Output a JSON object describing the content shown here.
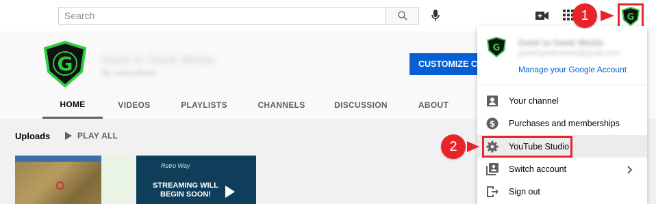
{
  "search": {
    "placeholder": "Search"
  },
  "channel": {
    "name": "Geek to Geek Media",
    "subscribers": "No subscribers",
    "customize_label": "CUSTOMIZE CHANNEL"
  },
  "tabs": [
    {
      "label": "HOME",
      "active": true
    },
    {
      "label": "VIDEOS",
      "active": false
    },
    {
      "label": "PLAYLISTS",
      "active": false
    },
    {
      "label": "CHANNELS",
      "active": false
    },
    {
      "label": "DISCUSSION",
      "active": false
    },
    {
      "label": "ABOUT",
      "active": false
    }
  ],
  "uploads": {
    "title": "Uploads",
    "play_all": "PLAY ALL"
  },
  "thumbnails": [
    {
      "name": "map-game-thumbnail"
    },
    {
      "name": "stream-thumbnail",
      "text_line1": "STREAMING WILL",
      "text_line2": "BEGIN SOON!",
      "logo_text": "Retro Way"
    }
  ],
  "account_menu": {
    "name": "Geek to Geek Media",
    "email": "geektogeekmedia@gmail.com",
    "manage_label": "Manage your Google Account",
    "items": [
      {
        "label": "Your channel",
        "icon": "person-icon"
      },
      {
        "label": "Purchases and memberships",
        "icon": "dollar-icon"
      },
      {
        "label": "YouTube Studio",
        "icon": "gear-icon",
        "highlighted": true
      },
      {
        "label": "Switch account",
        "icon": "switch-account-icon",
        "has_chevron": true
      },
      {
        "label": "Sign out",
        "icon": "sign-out-icon"
      }
    ]
  },
  "annotations": {
    "step1": "1",
    "step2": "2"
  },
  "colors": {
    "annotation_red": "#e8232a",
    "brand_blue": "#065fd4",
    "logo_green": "#2ecc40"
  }
}
